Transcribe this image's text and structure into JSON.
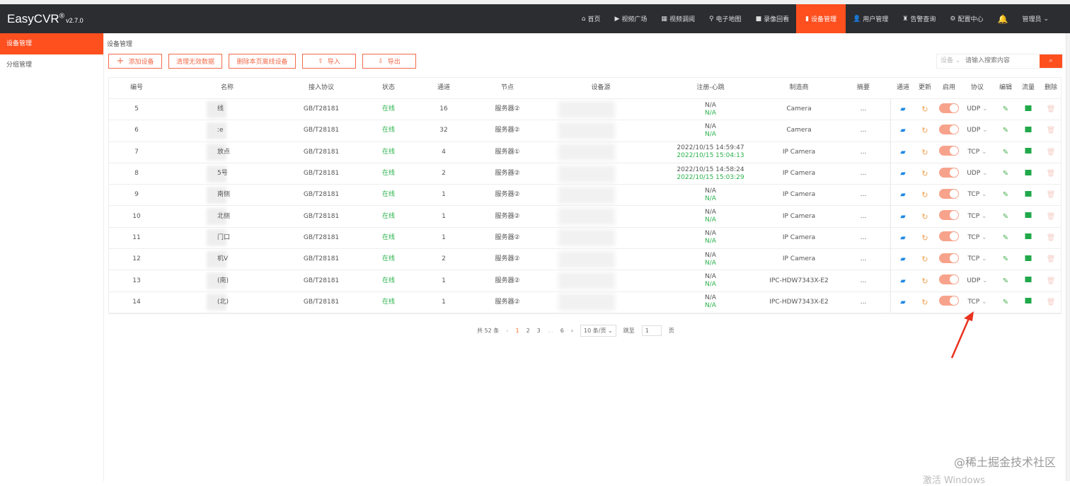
{
  "app": {
    "logo": "EasyCVR",
    "reg": "®",
    "version": "v2.7.0"
  },
  "nav": [
    {
      "icon": "home-icon",
      "glyph": "⌂",
      "label": "首页"
    },
    {
      "icon": "play-icon",
      "glyph": "▶",
      "label": "视频广场"
    },
    {
      "icon": "grid-icon",
      "glyph": "▦",
      "label": "视频调阅"
    },
    {
      "icon": "map-pin-icon",
      "glyph": "⚲",
      "label": "电子地图"
    },
    {
      "icon": "video-icon",
      "glyph": "■",
      "label": "录像回看"
    },
    {
      "icon": "device-icon",
      "glyph": "▮",
      "label": "设备管理",
      "active": true
    },
    {
      "icon": "user-icon",
      "glyph": "👤",
      "label": "用户管理"
    },
    {
      "icon": "alarm-icon",
      "glyph": "♜",
      "label": "告警查询"
    },
    {
      "icon": "gear-icon",
      "glyph": "⚙",
      "label": "配置中心"
    }
  ],
  "user": {
    "label": "管理员"
  },
  "sidebar": [
    {
      "label": "设备管理",
      "active": true
    },
    {
      "label": "分组管理"
    }
  ],
  "breadcrumb": "设备管理",
  "toolbar": {
    "add": "添加设备",
    "clear": "清理无效数据",
    "delete_offline": "删除本页离线设备",
    "import": "导入",
    "export": "导出"
  },
  "search": {
    "scope": "设备",
    "placeholder": "请输入搜索内容"
  },
  "columns": [
    "编号",
    "名称",
    "接入协议",
    "状态",
    "通道",
    "节点",
    "设备源",
    "注册-心跳",
    "制造商",
    "摘要",
    "通道",
    "更新",
    "启用",
    "协议",
    "编辑",
    "流量",
    "删除"
  ],
  "rows": [
    {
      "id": "5",
      "name": "线",
      "proto": "GB/T28181",
      "status": "在线",
      "ch": "16",
      "node": "服务器②",
      "reg": "N/A",
      "hb": "N/A",
      "maker": "Camera",
      "sum": "...",
      "tp": "UDP"
    },
    {
      "id": "6",
      "name": "ːe",
      "proto": "GB/T28181",
      "status": "在线",
      "ch": "32",
      "node": "服务器②",
      "reg": "N/A",
      "hb": "N/A",
      "maker": "Camera",
      "sum": "...",
      "tp": "UDP"
    },
    {
      "id": "7",
      "name": "放点",
      "proto": "GB/T28181",
      "status": "在线",
      "ch": "4",
      "node": "服务器①",
      "reg": "2022/10/15 14:59:47",
      "hb": "2022/10/15 15:04:13",
      "maker": "IP Camera",
      "sum": "...",
      "tp": "TCP"
    },
    {
      "id": "8",
      "name": "5号",
      "proto": "GB/T28181",
      "status": "在线",
      "ch": "2",
      "node": "服务器②",
      "reg": "2022/10/15 14:58:24",
      "hb": "2022/10/15 15:03:29",
      "maker": "IP Camera",
      "sum": "...",
      "tp": "UDP"
    },
    {
      "id": "9",
      "name": "南侧",
      "proto": "GB/T28181",
      "status": "在线",
      "ch": "1",
      "node": "服务器②",
      "reg": "N/A",
      "hb": "N/A",
      "maker": "IP Camera",
      "sum": "...",
      "tp": "TCP"
    },
    {
      "id": "10",
      "name": "北侧",
      "proto": "GB/T28181",
      "status": "在线",
      "ch": "1",
      "node": "服务器②",
      "reg": "N/A",
      "hb": "N/A",
      "maker": "IP Camera",
      "sum": "...",
      "tp": "TCP"
    },
    {
      "id": "11",
      "name": "门口",
      "proto": "GB/T28181",
      "status": "在线",
      "ch": "1",
      "node": "服务器②",
      "reg": "N/A",
      "hb": "N/A",
      "maker": "IP Camera",
      "sum": "...",
      "tp": "TCP"
    },
    {
      "id": "12",
      "name": "机V",
      "proto": "GB/T28181",
      "status": "在线",
      "ch": "2",
      "node": "服务器②",
      "reg": "N/A",
      "hb": "N/A",
      "maker": "IP Camera",
      "sum": "...",
      "tp": "TCP"
    },
    {
      "id": "13",
      "name": "(南)",
      "proto": "GB/T28181",
      "status": "在线",
      "ch": "1",
      "node": "服务器②",
      "reg": "N/A",
      "hb": "N/A",
      "maker": "IPC-HDW7343X-E2",
      "sum": "...",
      "tp": "UDP"
    },
    {
      "id": "14",
      "name": "(北)",
      "proto": "GB/T28181",
      "status": "在线",
      "ch": "1",
      "node": "服务器②",
      "reg": "N/A",
      "hb": "N/A",
      "maker": "IPC-HDW7343X-E2",
      "sum": "...",
      "tp": "TCP"
    }
  ],
  "pagination": {
    "total": "共 52 条",
    "prev": "‹",
    "pages": [
      "1",
      "2",
      "3",
      "…",
      "6"
    ],
    "current": "1",
    "next": "›",
    "size": "10 条/页",
    "goto": "跳至",
    "goto_value": "1",
    "page_suffix": "页"
  },
  "watermark": "@稀土掘金技术社区",
  "windows_watermark": "激活 Windows",
  "colors": {
    "accent": "#fe4f1f",
    "online": "#2bb24c",
    "nav": "#2b2d31"
  }
}
